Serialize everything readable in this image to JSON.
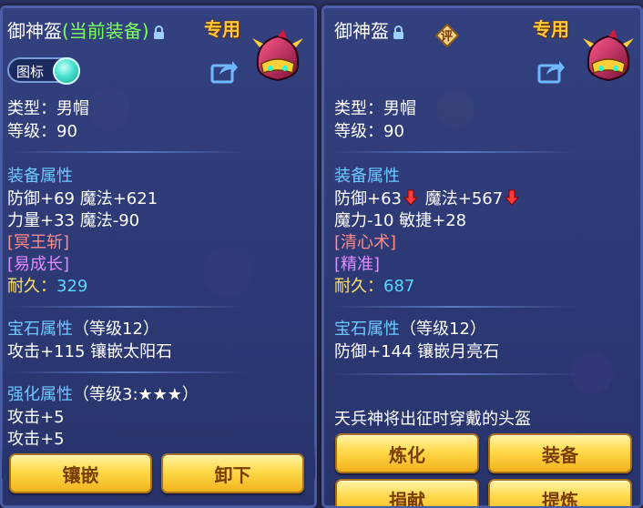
{
  "left_panel": {
    "title": "御神盔",
    "equipped_tag": "(当前装备)",
    "special_tag": "专用",
    "toggle_label": "图标",
    "type_line": "类型：男帽",
    "level_line": "等级：90",
    "equip_attr_header": "装备属性",
    "attr_line_1": "防御+69 魔法+621",
    "attr_line_2": "力量+33 魔法-90",
    "skill_1": "[冥王斩]",
    "skill_2": "[易成长]",
    "durability_label": "耐久：",
    "durability_value": "329",
    "gem_header": "宝石属性",
    "gem_level": "（等级12）",
    "gem_line": "攻击+115 镶嵌太阳石",
    "enhance_header": "强化属性",
    "enhance_level": "（等级3:★★★）",
    "enhance_line_1": "攻击+5",
    "enhance_line_2": "攻击+5",
    "buttons": {
      "inlay": "镶嵌",
      "unequip": "卸下"
    }
  },
  "right_panel": {
    "title": "御神盔",
    "rate_badge": "评",
    "special_tag": "专用",
    "type_line": "类型：男帽",
    "level_line": "等级：90",
    "equip_attr_header": "装备属性",
    "attr_defense": "防御+63",
    "attr_magic": "魔法+567",
    "attr_line_2": "魔力-10 敏捷+28",
    "skill_1": "[清心术]",
    "skill_2": "[精准]",
    "durability_label": "耐久：",
    "durability_value": "687",
    "gem_header": "宝石属性",
    "gem_level": "（等级12）",
    "gem_line": "防御+144 镶嵌月亮石",
    "description": "天兵神将出征时穿戴的头盔",
    "buttons": {
      "refine": "炼化",
      "equip": "装备",
      "donate": "捐献",
      "extract": "提炼"
    }
  },
  "colors": {
    "accent_gold": "#FFC83A",
    "equipped_green": "#7CFF5A",
    "section_blue": "#6fc8ff",
    "value_cyan": "#57d6ff",
    "down_arrow": "#ff3a3a"
  }
}
